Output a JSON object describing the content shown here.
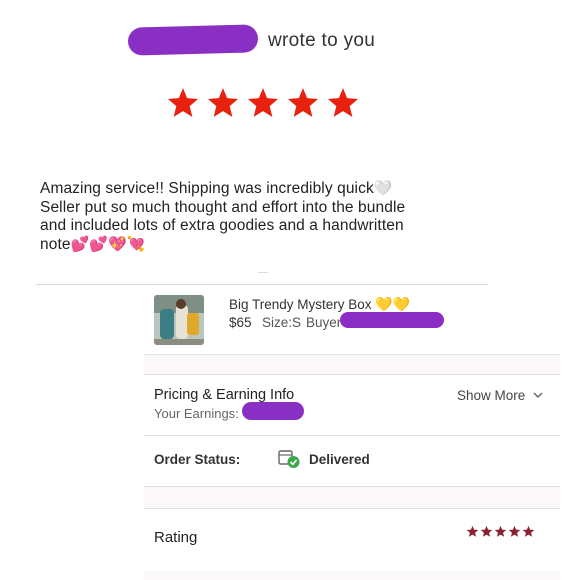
{
  "header": {
    "text": "wrote to you"
  },
  "review": {
    "line1": "Amazing service!! Shipping was incredibly quick",
    "line2": "Seller put so much thought and effort into the bundle",
    "line3": "and included lots of extra goodies and a handwritten",
    "line4": "note",
    "rating_stars": 5
  },
  "item": {
    "title": "Big Trendy Mystery Box",
    "price": "$65",
    "size": "Size:S",
    "buyer_label": "Buyer"
  },
  "pricing": {
    "title": "Pricing & Earning Info",
    "earnings_label": "Your Earnings:",
    "show_more": "Show More"
  },
  "order": {
    "status_label": "Order Status:",
    "status_value": "Delivered"
  },
  "rating": {
    "label": "Rating",
    "stars": 5
  },
  "colors": {
    "big_star": "#e8200e",
    "small_star": "#8b2233",
    "redaction": "#8a2fc4",
    "delivered_check": "#3aa84a"
  }
}
